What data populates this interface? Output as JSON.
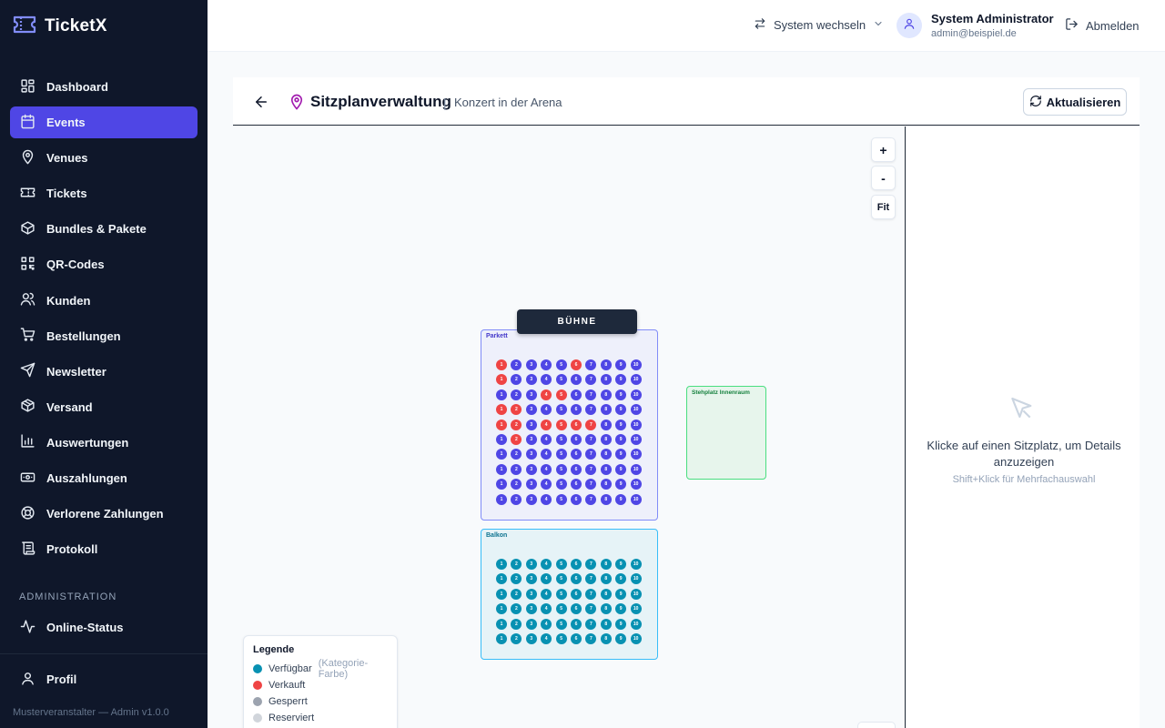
{
  "app": {
    "name": "TicketX",
    "version_text": "Musterveranstalter — Admin v1.0.0"
  },
  "sidebar": {
    "items": [
      {
        "label": "Dashboard",
        "icon": "dashboard-icon"
      },
      {
        "label": "Events",
        "icon": "calendar-icon",
        "active": true
      },
      {
        "label": "Venues",
        "icon": "map-pin-icon"
      },
      {
        "label": "Tickets",
        "icon": "ticket-icon"
      },
      {
        "label": "Bundles & Pakete",
        "icon": "package-icon"
      },
      {
        "label": "QR-Codes",
        "icon": "qr-code-icon"
      },
      {
        "label": "Kunden",
        "icon": "users-icon"
      },
      {
        "label": "Bestellungen",
        "icon": "cart-icon"
      },
      {
        "label": "Newsletter",
        "icon": "send-icon"
      },
      {
        "label": "Versand",
        "icon": "box-icon"
      },
      {
        "label": "Auswertungen",
        "icon": "bar-chart-icon"
      },
      {
        "label": "Auszahlungen",
        "icon": "banknote-icon"
      },
      {
        "label": "Verlorene Zahlungen",
        "icon": "lifebuoy-icon"
      },
      {
        "label": "Protokoll",
        "icon": "scroll-icon"
      }
    ],
    "admin_section_label": "ADMINISTRATION",
    "admin_item": {
      "label": "Online-Status",
      "icon": "activity-icon"
    },
    "profile_item": {
      "label": "Profil",
      "icon": "user-icon"
    }
  },
  "header": {
    "switch_label": "System wechseln",
    "user_name": "System Administrator",
    "user_email": "admin@beispiel.de",
    "logout_label": "Abmelden"
  },
  "page": {
    "title": "Sitzplanverwaltung",
    "separator": "|",
    "subtitle": "Konzert in der Arena",
    "refresh_label": "Aktualisieren"
  },
  "canvas": {
    "zoom_in": "+",
    "zoom_out": "-",
    "fit": "Fit",
    "stage_label": "BÜHNE",
    "blocks": {
      "parkett": {
        "label": "Parkett",
        "rows": 10,
        "seats_per_row": 10,
        "color": "#4f46e5",
        "sold": [
          [
            0,
            0
          ],
          [
            0,
            5
          ],
          [
            1,
            0
          ],
          [
            2,
            3
          ],
          [
            2,
            4
          ],
          [
            3,
            0
          ],
          [
            3,
            1
          ],
          [
            4,
            0
          ],
          [
            4,
            1
          ],
          [
            4,
            3
          ],
          [
            4,
            4
          ],
          [
            4,
            5
          ],
          [
            4,
            6
          ],
          [
            5,
            1
          ]
        ]
      },
      "balkon": {
        "label": "Balkon",
        "rows": 6,
        "seats_per_row": 10,
        "color": "#0891b2",
        "sold": []
      },
      "standing": {
        "label": "Stehplatz Innenraum"
      }
    },
    "sold_color": "#ef4444",
    "legend": {
      "title": "Legende",
      "items": [
        {
          "label": "Verfügbar",
          "note": "(Kategorie-Farbe)",
          "color": "#0891b2"
        },
        {
          "label": "Verkauft",
          "note": "",
          "color": "#ef4444"
        },
        {
          "label": "Gesperrt",
          "note": "",
          "color": "#9ca3af"
        },
        {
          "label": "Reserviert",
          "note": "",
          "color": "#d1d5db"
        }
      ]
    }
  },
  "details": {
    "message": "Klicke auf einen Sitzplatz, um Details anzuzeigen",
    "hint": "Shift+Klick für Mehrfachauswahl"
  }
}
